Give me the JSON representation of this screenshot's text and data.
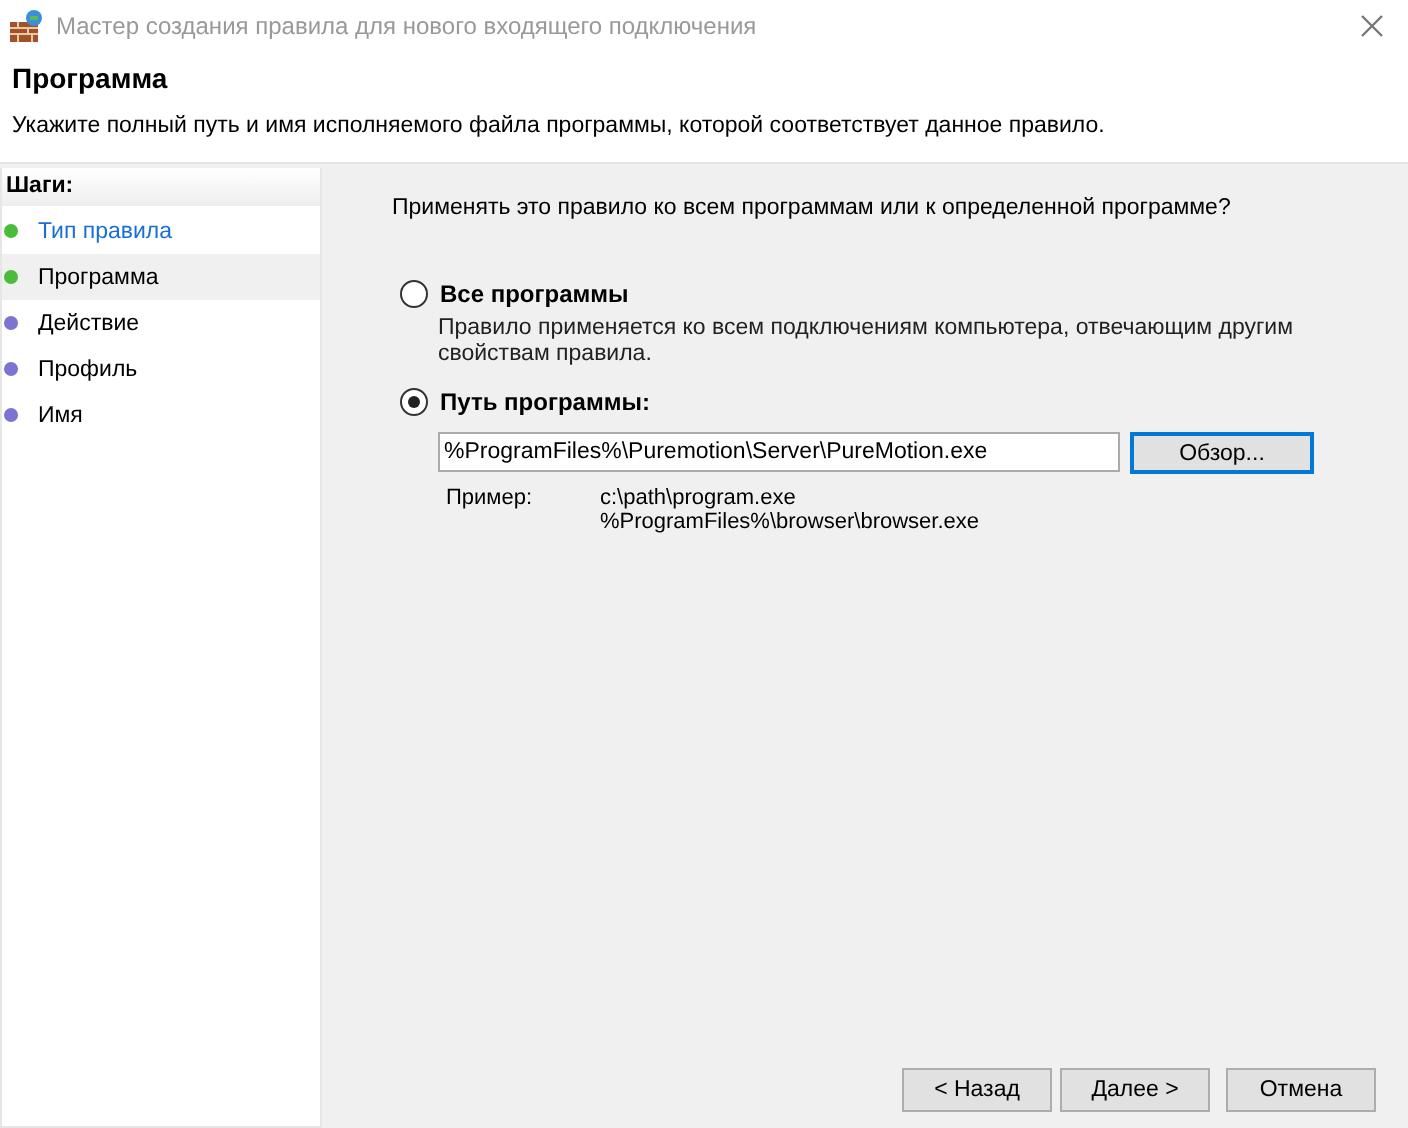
{
  "window": {
    "title": "Мастер создания правила для нового входящего подключения"
  },
  "header": {
    "title": "Программа",
    "description": "Укажите полный путь и имя исполняемого файла программы, которой соответствует данное правило."
  },
  "sidebar": {
    "title": "Шаги:",
    "items": [
      {
        "label": "Тип правила",
        "link": true,
        "selected": false,
        "color": "#4cbb3c"
      },
      {
        "label": "Программа",
        "link": false,
        "selected": true,
        "color": "#4cbb3c"
      },
      {
        "label": "Действие",
        "link": false,
        "selected": false,
        "color": "#7b74d0"
      },
      {
        "label": "Профиль",
        "link": false,
        "selected": false,
        "color": "#7b74d0"
      },
      {
        "label": "Имя",
        "link": false,
        "selected": false,
        "color": "#7b74d0"
      }
    ]
  },
  "question": "Применять это правило ко всем программам или к определенной программе?",
  "options": [
    {
      "label": "Все программы",
      "selected": false,
      "description": "Правило применяется ко всем подключениям компьютера, отвечающим другим свойствам правила."
    },
    {
      "label": "Путь программы:",
      "selected": true
    }
  ],
  "path_field": {
    "value": "%ProgramFiles%\\Puremotion\\Server\\PureMotion.exe"
  },
  "browse_button": "Обзор...",
  "example": {
    "label": "Пример:",
    "lines": [
      "c:\\path\\program.exe",
      "%ProgramFiles%\\browser\\browser.exe"
    ]
  },
  "buttons": [
    "< Назад",
    "Далее >",
    "Отмена"
  ]
}
